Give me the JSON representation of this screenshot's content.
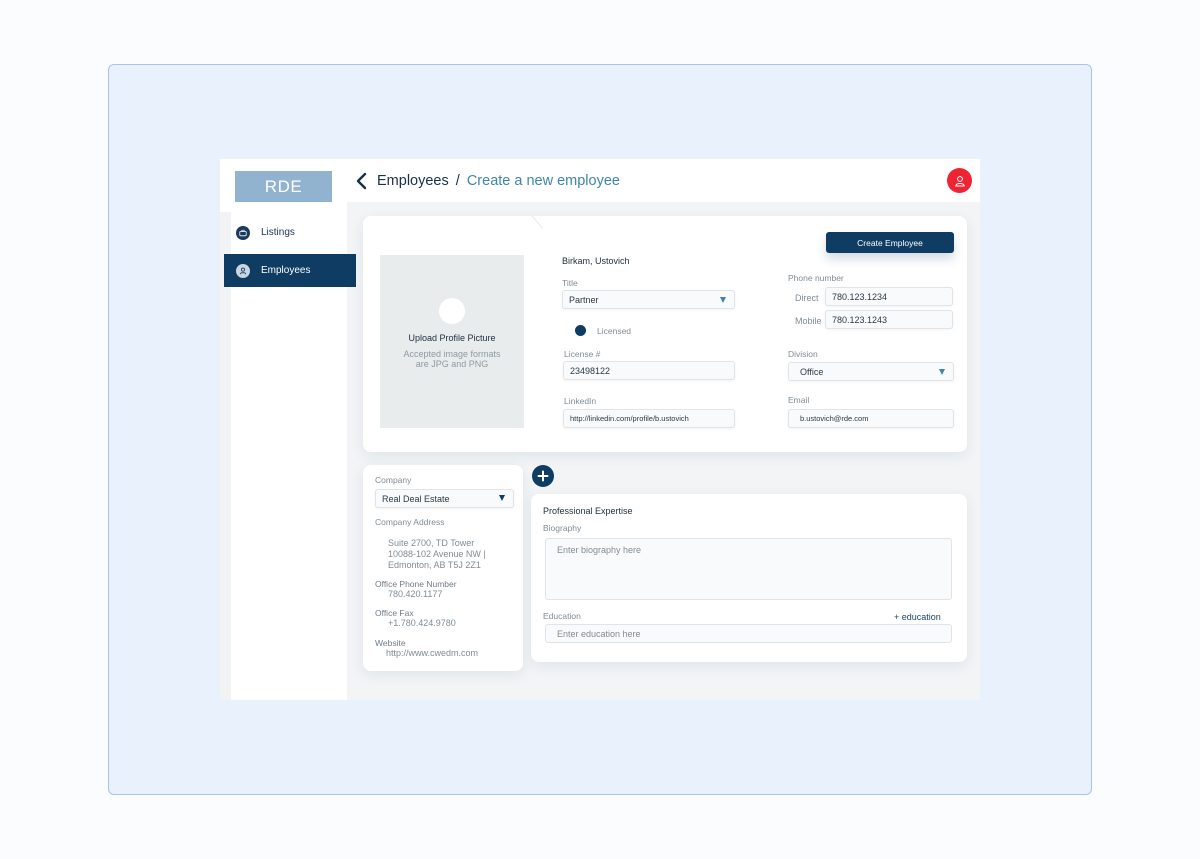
{
  "colors": {
    "primary": "#0e3c62",
    "accent": "#3d86a8",
    "avatar": "#ee2434",
    "logo_bg": "#91b3cf"
  },
  "sidebar": {
    "logo": "RDE",
    "items": [
      {
        "label": "Listings",
        "icon": "briefcase-icon",
        "active": false
      },
      {
        "label": "Employees",
        "icon": "user-icon",
        "active": true
      }
    ]
  },
  "header": {
    "breadcrumb_root": "Employees",
    "separator": "/",
    "breadcrumb_current": "Create a new employee",
    "back_icon": "chevron-left-icon",
    "avatar_icon": "user-icon"
  },
  "profile": {
    "upload_title": "Upload Profile Picture",
    "upload_hint": "Accepted image formats are JPG and PNG",
    "create_button": "Create Employee",
    "name": "Birkam, Ustovich",
    "title_label": "Title",
    "title_value": "Partner",
    "licensed_label": "Licensed",
    "license_label": "License #",
    "license_value": "23498122",
    "linkedin_label": "LinkedIn",
    "linkedin_value": "http://linkedin.com/profile/b.ustovich",
    "phone_label": "Phone number",
    "direct_label": "Direct",
    "direct_value": "780.123.1234",
    "mobile_label": "Mobile",
    "mobile_value": "780.123.1243",
    "division_label": "Division",
    "division_value": "Office",
    "email_label": "Email",
    "email_value": "b.ustovich@rde.com"
  },
  "company": {
    "company_label": "Company",
    "company_value": "Real Deal Estate",
    "address_label": "Company Address",
    "address_line1": "Suite 2700, TD Tower",
    "address_line2": "10088-102 Avenue NW |",
    "address_line3": "Edmonton, AB T5J 2Z1",
    "phone_label": "Office Phone Number",
    "phone_value": "780.420.1177",
    "fax_label": "Office Fax",
    "fax_value": "+1.780.424.9780",
    "website_label": "Website",
    "website_value": "http://www.cwedm.com"
  },
  "expertise": {
    "section_title": "Professional Expertise",
    "biography_label": "Biography",
    "biography_placeholder": "Enter biography here",
    "education_label": "Education",
    "add_education": "+ education",
    "education_placeholder": "Enter education here",
    "add_icon": "plus-icon"
  }
}
